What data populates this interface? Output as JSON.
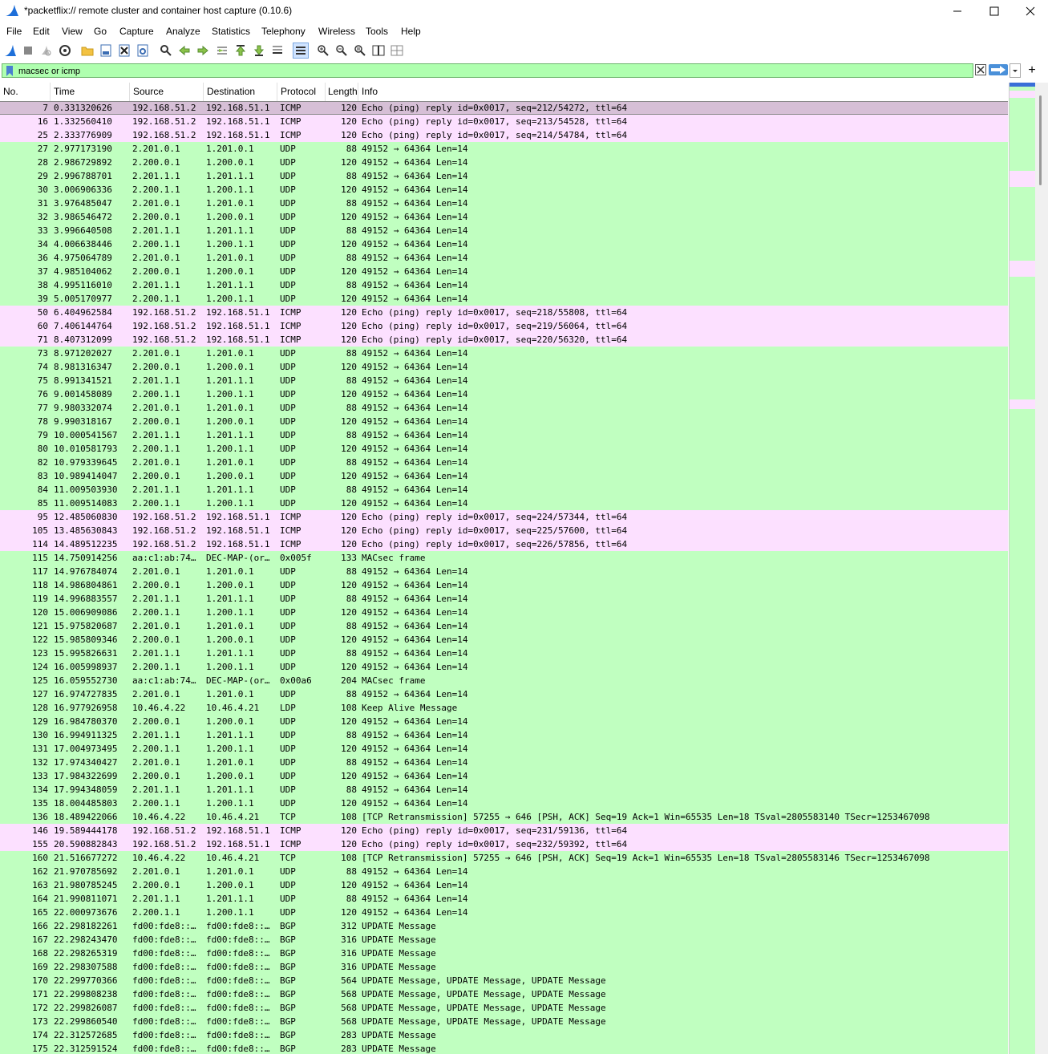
{
  "window": {
    "title": "*packetflix:// remote cluster and container host capture (0.10.6)",
    "controls": [
      "minimize-icon",
      "maximize-icon",
      "close-icon"
    ]
  },
  "menu": [
    "File",
    "Edit",
    "View",
    "Go",
    "Capture",
    "Analyze",
    "Statistics",
    "Telephony",
    "Wireless",
    "Tools",
    "Help"
  ],
  "filter": {
    "value": "macsec or icmp",
    "color": "#afffaf"
  },
  "columns": [
    "No.",
    "Time",
    "Source",
    "Destination",
    "Protocol",
    "Length",
    "Info"
  ],
  "colors": {
    "icmp_row": "#fce0ff",
    "other_row": "#c0ffc0",
    "selected_row": "#d6bfd6"
  },
  "packets": [
    {
      "no": "7",
      "time": "0.331320626",
      "src": "192.168.51.2",
      "dst": "192.168.51.1",
      "proto": "ICMP",
      "len": "120",
      "info": "Echo (ping) reply    id=0x0017, seq=212/54272, ttl=64",
      "kind": "selected"
    },
    {
      "no": "16",
      "time": "1.332560410",
      "src": "192.168.51.2",
      "dst": "192.168.51.1",
      "proto": "ICMP",
      "len": "120",
      "info": "Echo (ping) reply    id=0x0017, seq=213/54528, ttl=64",
      "kind": "icmp"
    },
    {
      "no": "25",
      "time": "2.333776909",
      "src": "192.168.51.2",
      "dst": "192.168.51.1",
      "proto": "ICMP",
      "len": "120",
      "info": "Echo (ping) reply    id=0x0017, seq=214/54784, ttl=64",
      "kind": "icmp"
    },
    {
      "no": "27",
      "time": "2.977173190",
      "src": "2.201.0.1",
      "dst": "1.201.0.1",
      "proto": "UDP",
      "len": "88",
      "info": "49152 → 64364 Len=14",
      "kind": "other"
    },
    {
      "no": "28",
      "time": "2.986729892",
      "src": "2.200.0.1",
      "dst": "1.200.0.1",
      "proto": "UDP",
      "len": "120",
      "info": "49152 → 64364 Len=14",
      "kind": "other"
    },
    {
      "no": "29",
      "time": "2.996788701",
      "src": "2.201.1.1",
      "dst": "1.201.1.1",
      "proto": "UDP",
      "len": "88",
      "info": "49152 → 64364 Len=14",
      "kind": "other"
    },
    {
      "no": "30",
      "time": "3.006906336",
      "src": "2.200.1.1",
      "dst": "1.200.1.1",
      "proto": "UDP",
      "len": "120",
      "info": "49152 → 64364 Len=14",
      "kind": "other"
    },
    {
      "no": "31",
      "time": "3.976485047",
      "src": "2.201.0.1",
      "dst": "1.201.0.1",
      "proto": "UDP",
      "len": "88",
      "info": "49152 → 64364 Len=14",
      "kind": "other"
    },
    {
      "no": "32",
      "time": "3.986546472",
      "src": "2.200.0.1",
      "dst": "1.200.0.1",
      "proto": "UDP",
      "len": "120",
      "info": "49152 → 64364 Len=14",
      "kind": "other"
    },
    {
      "no": "33",
      "time": "3.996640508",
      "src": "2.201.1.1",
      "dst": "1.201.1.1",
      "proto": "UDP",
      "len": "88",
      "info": "49152 → 64364 Len=14",
      "kind": "other"
    },
    {
      "no": "34",
      "time": "4.006638446",
      "src": "2.200.1.1",
      "dst": "1.200.1.1",
      "proto": "UDP",
      "len": "120",
      "info": "49152 → 64364 Len=14",
      "kind": "other"
    },
    {
      "no": "36",
      "time": "4.975064789",
      "src": "2.201.0.1",
      "dst": "1.201.0.1",
      "proto": "UDP",
      "len": "88",
      "info": "49152 → 64364 Len=14",
      "kind": "other"
    },
    {
      "no": "37",
      "time": "4.985104062",
      "src": "2.200.0.1",
      "dst": "1.200.0.1",
      "proto": "UDP",
      "len": "120",
      "info": "49152 → 64364 Len=14",
      "kind": "other"
    },
    {
      "no": "38",
      "time": "4.995116010",
      "src": "2.201.1.1",
      "dst": "1.201.1.1",
      "proto": "UDP",
      "len": "88",
      "info": "49152 → 64364 Len=14",
      "kind": "other"
    },
    {
      "no": "39",
      "time": "5.005170977",
      "src": "2.200.1.1",
      "dst": "1.200.1.1",
      "proto": "UDP",
      "len": "120",
      "info": "49152 → 64364 Len=14",
      "kind": "other"
    },
    {
      "no": "50",
      "time": "6.404962584",
      "src": "192.168.51.2",
      "dst": "192.168.51.1",
      "proto": "ICMP",
      "len": "120",
      "info": "Echo (ping) reply    id=0x0017, seq=218/55808, ttl=64",
      "kind": "icmp"
    },
    {
      "no": "60",
      "time": "7.406144764",
      "src": "192.168.51.2",
      "dst": "192.168.51.1",
      "proto": "ICMP",
      "len": "120",
      "info": "Echo (ping) reply    id=0x0017, seq=219/56064, ttl=64",
      "kind": "icmp"
    },
    {
      "no": "71",
      "time": "8.407312099",
      "src": "192.168.51.2",
      "dst": "192.168.51.1",
      "proto": "ICMP",
      "len": "120",
      "info": "Echo (ping) reply    id=0x0017, seq=220/56320, ttl=64",
      "kind": "icmp"
    },
    {
      "no": "73",
      "time": "8.971202027",
      "src": "2.201.0.1",
      "dst": "1.201.0.1",
      "proto": "UDP",
      "len": "88",
      "info": "49152 → 64364 Len=14",
      "kind": "other"
    },
    {
      "no": "74",
      "time": "8.981316347",
      "src": "2.200.0.1",
      "dst": "1.200.0.1",
      "proto": "UDP",
      "len": "120",
      "info": "49152 → 64364 Len=14",
      "kind": "other"
    },
    {
      "no": "75",
      "time": "8.991341521",
      "src": "2.201.1.1",
      "dst": "1.201.1.1",
      "proto": "UDP",
      "len": "88",
      "info": "49152 → 64364 Len=14",
      "kind": "other"
    },
    {
      "no": "76",
      "time": "9.001458089",
      "src": "2.200.1.1",
      "dst": "1.200.1.1",
      "proto": "UDP",
      "len": "120",
      "info": "49152 → 64364 Len=14",
      "kind": "other"
    },
    {
      "no": "77",
      "time": "9.980332074",
      "src": "2.201.0.1",
      "dst": "1.201.0.1",
      "proto": "UDP",
      "len": "88",
      "info": "49152 → 64364 Len=14",
      "kind": "other"
    },
    {
      "no": "78",
      "time": "9.990318167",
      "src": "2.200.0.1",
      "dst": "1.200.0.1",
      "proto": "UDP",
      "len": "120",
      "info": "49152 → 64364 Len=14",
      "kind": "other"
    },
    {
      "no": "79",
      "time": "10.000541567",
      "src": "2.201.1.1",
      "dst": "1.201.1.1",
      "proto": "UDP",
      "len": "88",
      "info": "49152 → 64364 Len=14",
      "kind": "other"
    },
    {
      "no": "80",
      "time": "10.010581793",
      "src": "2.200.1.1",
      "dst": "1.200.1.1",
      "proto": "UDP",
      "len": "120",
      "info": "49152 → 64364 Len=14",
      "kind": "other"
    },
    {
      "no": "82",
      "time": "10.979339645",
      "src": "2.201.0.1",
      "dst": "1.201.0.1",
      "proto": "UDP",
      "len": "88",
      "info": "49152 → 64364 Len=14",
      "kind": "other"
    },
    {
      "no": "83",
      "time": "10.989414047",
      "src": "2.200.0.1",
      "dst": "1.200.0.1",
      "proto": "UDP",
      "len": "120",
      "info": "49152 → 64364 Len=14",
      "kind": "other"
    },
    {
      "no": "84",
      "time": "11.009503930",
      "src": "2.201.1.1",
      "dst": "1.201.1.1",
      "proto": "UDP",
      "len": "88",
      "info": "49152 → 64364 Len=14",
      "kind": "other"
    },
    {
      "no": "85",
      "time": "11.009514083",
      "src": "2.200.1.1",
      "dst": "1.200.1.1",
      "proto": "UDP",
      "len": "120",
      "info": "49152 → 64364 Len=14",
      "kind": "other"
    },
    {
      "no": "95",
      "time": "12.485060830",
      "src": "192.168.51.2",
      "dst": "192.168.51.1",
      "proto": "ICMP",
      "len": "120",
      "info": "Echo (ping) reply    id=0x0017, seq=224/57344, ttl=64",
      "kind": "icmp"
    },
    {
      "no": "105",
      "time": "13.485630843",
      "src": "192.168.51.2",
      "dst": "192.168.51.1",
      "proto": "ICMP",
      "len": "120",
      "info": "Echo (ping) reply    id=0x0017, seq=225/57600, ttl=64",
      "kind": "icmp"
    },
    {
      "no": "114",
      "time": "14.489512235",
      "src": "192.168.51.2",
      "dst": "192.168.51.1",
      "proto": "ICMP",
      "len": "120",
      "info": "Echo (ping) reply    id=0x0017, seq=226/57856, ttl=64",
      "kind": "icmp"
    },
    {
      "no": "115",
      "time": "14.750914256",
      "src": "aa:c1:ab:74…",
      "dst": "DEC-MAP-(or…",
      "proto": "0x005f",
      "len": "133",
      "info": "MACsec frame",
      "kind": "other"
    },
    {
      "no": "117",
      "time": "14.976784074",
      "src": "2.201.0.1",
      "dst": "1.201.0.1",
      "proto": "UDP",
      "len": "88",
      "info": "49152 → 64364 Len=14",
      "kind": "other"
    },
    {
      "no": "118",
      "time": "14.986804861",
      "src": "2.200.0.1",
      "dst": "1.200.0.1",
      "proto": "UDP",
      "len": "120",
      "info": "49152 → 64364 Len=14",
      "kind": "other"
    },
    {
      "no": "119",
      "time": "14.996883557",
      "src": "2.201.1.1",
      "dst": "1.201.1.1",
      "proto": "UDP",
      "len": "88",
      "info": "49152 → 64364 Len=14",
      "kind": "other"
    },
    {
      "no": "120",
      "time": "15.006909086",
      "src": "2.200.1.1",
      "dst": "1.200.1.1",
      "proto": "UDP",
      "len": "120",
      "info": "49152 → 64364 Len=14",
      "kind": "other"
    },
    {
      "no": "121",
      "time": "15.975820687",
      "src": "2.201.0.1",
      "dst": "1.201.0.1",
      "proto": "UDP",
      "len": "88",
      "info": "49152 → 64364 Len=14",
      "kind": "other"
    },
    {
      "no": "122",
      "time": "15.985809346",
      "src": "2.200.0.1",
      "dst": "1.200.0.1",
      "proto": "UDP",
      "len": "120",
      "info": "49152 → 64364 Len=14",
      "kind": "other"
    },
    {
      "no": "123",
      "time": "15.995826631",
      "src": "2.201.1.1",
      "dst": "1.201.1.1",
      "proto": "UDP",
      "len": "88",
      "info": "49152 → 64364 Len=14",
      "kind": "other"
    },
    {
      "no": "124",
      "time": "16.005998937",
      "src": "2.200.1.1",
      "dst": "1.200.1.1",
      "proto": "UDP",
      "len": "120",
      "info": "49152 → 64364 Len=14",
      "kind": "other"
    },
    {
      "no": "125",
      "time": "16.059552730",
      "src": "aa:c1:ab:74…",
      "dst": "DEC-MAP-(or…",
      "proto": "0x00a6",
      "len": "204",
      "info": "MACsec frame",
      "kind": "other"
    },
    {
      "no": "127",
      "time": "16.974727835",
      "src": "2.201.0.1",
      "dst": "1.201.0.1",
      "proto": "UDP",
      "len": "88",
      "info": "49152 → 64364 Len=14",
      "kind": "other"
    },
    {
      "no": "128",
      "time": "16.977926958",
      "src": "10.46.4.22",
      "dst": "10.46.4.21",
      "proto": "LDP",
      "len": "108",
      "info": "Keep Alive Message",
      "kind": "other"
    },
    {
      "no": "129",
      "time": "16.984780370",
      "src": "2.200.0.1",
      "dst": "1.200.0.1",
      "proto": "UDP",
      "len": "120",
      "info": "49152 → 64364 Len=14",
      "kind": "other"
    },
    {
      "no": "130",
      "time": "16.994911325",
      "src": "2.201.1.1",
      "dst": "1.201.1.1",
      "proto": "UDP",
      "len": "88",
      "info": "49152 → 64364 Len=14",
      "kind": "other"
    },
    {
      "no": "131",
      "time": "17.004973495",
      "src": "2.200.1.1",
      "dst": "1.200.1.1",
      "proto": "UDP",
      "len": "120",
      "info": "49152 → 64364 Len=14",
      "kind": "other"
    },
    {
      "no": "132",
      "time": "17.974340427",
      "src": "2.201.0.1",
      "dst": "1.201.0.1",
      "proto": "UDP",
      "len": "88",
      "info": "49152 → 64364 Len=14",
      "kind": "other"
    },
    {
      "no": "133",
      "time": "17.984322699",
      "src": "2.200.0.1",
      "dst": "1.200.0.1",
      "proto": "UDP",
      "len": "120",
      "info": "49152 → 64364 Len=14",
      "kind": "other"
    },
    {
      "no": "134",
      "time": "17.994348059",
      "src": "2.201.1.1",
      "dst": "1.201.1.1",
      "proto": "UDP",
      "len": "88",
      "info": "49152 → 64364 Len=14",
      "kind": "other"
    },
    {
      "no": "135",
      "time": "18.004485803",
      "src": "2.200.1.1",
      "dst": "1.200.1.1",
      "proto": "UDP",
      "len": "120",
      "info": "49152 → 64364 Len=14",
      "kind": "other"
    },
    {
      "no": "136",
      "time": "18.489422066",
      "src": "10.46.4.22",
      "dst": "10.46.4.21",
      "proto": "TCP",
      "len": "108",
      "info": "[TCP Retransmission] 57255 → 646 [PSH, ACK] Seq=19 Ack=1 Win=65535 Len=18 TSval=2805583140 TSecr=1253467098",
      "kind": "other"
    },
    {
      "no": "146",
      "time": "19.589444178",
      "src": "192.168.51.2",
      "dst": "192.168.51.1",
      "proto": "ICMP",
      "len": "120",
      "info": "Echo (ping) reply    id=0x0017, seq=231/59136, ttl=64",
      "kind": "icmp"
    },
    {
      "no": "155",
      "time": "20.590882843",
      "src": "192.168.51.2",
      "dst": "192.168.51.1",
      "proto": "ICMP",
      "len": "120",
      "info": "Echo (ping) reply    id=0x0017, seq=232/59392, ttl=64",
      "kind": "icmp"
    },
    {
      "no": "160",
      "time": "21.516677272",
      "src": "10.46.4.22",
      "dst": "10.46.4.21",
      "proto": "TCP",
      "len": "108",
      "info": "[TCP Retransmission] 57255 → 646 [PSH, ACK] Seq=19 Ack=1 Win=65535 Len=18 TSval=2805583146 TSecr=1253467098",
      "kind": "other"
    },
    {
      "no": "162",
      "time": "21.970785692",
      "src": "2.201.0.1",
      "dst": "1.201.0.1",
      "proto": "UDP",
      "len": "88",
      "info": "49152 → 64364 Len=14",
      "kind": "other"
    },
    {
      "no": "163",
      "time": "21.980785245",
      "src": "2.200.0.1",
      "dst": "1.200.0.1",
      "proto": "UDP",
      "len": "120",
      "info": "49152 → 64364 Len=14",
      "kind": "other"
    },
    {
      "no": "164",
      "time": "21.990811071",
      "src": "2.201.1.1",
      "dst": "1.201.1.1",
      "proto": "UDP",
      "len": "88",
      "info": "49152 → 64364 Len=14",
      "kind": "other"
    },
    {
      "no": "165",
      "time": "22.000973676",
      "src": "2.200.1.1",
      "dst": "1.200.1.1",
      "proto": "UDP",
      "len": "120",
      "info": "49152 → 64364 Len=14",
      "kind": "other"
    },
    {
      "no": "166",
      "time": "22.298182261",
      "src": "fd00:fde8::…",
      "dst": "fd00:fde8::…",
      "proto": "BGP",
      "len": "312",
      "info": "UPDATE Message",
      "kind": "other"
    },
    {
      "no": "167",
      "time": "22.298243470",
      "src": "fd00:fde8::…",
      "dst": "fd00:fde8::…",
      "proto": "BGP",
      "len": "316",
      "info": "UPDATE Message",
      "kind": "other"
    },
    {
      "no": "168",
      "time": "22.298265319",
      "src": "fd00:fde8::…",
      "dst": "fd00:fde8::…",
      "proto": "BGP",
      "len": "316",
      "info": "UPDATE Message",
      "kind": "other"
    },
    {
      "no": "169",
      "time": "22.298307588",
      "src": "fd00:fde8::…",
      "dst": "fd00:fde8::…",
      "proto": "BGP",
      "len": "316",
      "info": "UPDATE Message",
      "kind": "other"
    },
    {
      "no": "170",
      "time": "22.299770366",
      "src": "fd00:fde8::…",
      "dst": "fd00:fde8::…",
      "proto": "BGP",
      "len": "564",
      "info": "UPDATE Message, UPDATE Message, UPDATE Message",
      "kind": "other"
    },
    {
      "no": "171",
      "time": "22.299808238",
      "src": "fd00:fde8::…",
      "dst": "fd00:fde8::…",
      "proto": "BGP",
      "len": "568",
      "info": "UPDATE Message, UPDATE Message, UPDATE Message",
      "kind": "other"
    },
    {
      "no": "172",
      "time": "22.299826087",
      "src": "fd00:fde8::…",
      "dst": "fd00:fde8::…",
      "proto": "BGP",
      "len": "568",
      "info": "UPDATE Message, UPDATE Message, UPDATE Message",
      "kind": "other"
    },
    {
      "no": "173",
      "time": "22.299860540",
      "src": "fd00:fde8::…",
      "dst": "fd00:fde8::…",
      "proto": "BGP",
      "len": "568",
      "info": "UPDATE Message, UPDATE Message, UPDATE Message",
      "kind": "other"
    },
    {
      "no": "174",
      "time": "22.312572685",
      "src": "fd00:fde8::…",
      "dst": "fd00:fde8::…",
      "proto": "BGP",
      "len": "283",
      "info": "UPDATE Message",
      "kind": "other"
    },
    {
      "no": "175",
      "time": "22.312591524",
      "src": "fd00:fde8::…",
      "dst": "fd00:fde8::…",
      "proto": "BGP",
      "len": "283",
      "info": "UPDATE Message",
      "kind": "other"
    }
  ]
}
